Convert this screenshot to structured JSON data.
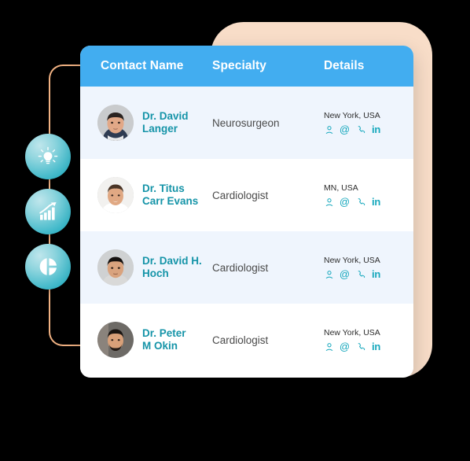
{
  "colors": {
    "header_blue": "#42adf0",
    "row_alt": "#eff5fd",
    "row_plain": "#ffffff",
    "name_teal": "#1594a8",
    "icon_teal": "#17a8bd",
    "peach_backdrop": "#f8ddc8",
    "connector_orange": "#f0b182",
    "badge_gradient_light": "#bfe6ec",
    "badge_gradient_dark": "#10a3b8",
    "canvas": "#000000"
  },
  "side_badges": [
    {
      "icon": "lightbulb-icon",
      "label": "Idea"
    },
    {
      "icon": "bar-chart-growth-icon",
      "label": "Growth"
    },
    {
      "icon": "pie-chart-icon",
      "label": "Analytics"
    }
  ],
  "table": {
    "columns": [
      {
        "key": "name",
        "label": "Contact Name"
      },
      {
        "key": "specialty",
        "label": "Specialty"
      },
      {
        "key": "details",
        "label": "Details"
      }
    ],
    "rows": [
      {
        "name_line1": "Dr. David",
        "name_line2": "Langer",
        "specialty": "Neurosurgeon",
        "location": "New York, USA",
        "avatar": "avatar-male-1",
        "detail_icons": [
          "person-icon",
          "email-at-icon",
          "phone-icon",
          "linkedin-icon"
        ]
      },
      {
        "name_line1": "Dr. Titus",
        "name_line2": "Carr Evans",
        "specialty": "Cardiologist",
        "location": "MN, USA",
        "avatar": "avatar-male-2",
        "detail_icons": [
          "person-icon",
          "email-at-icon",
          "phone-icon",
          "linkedin-icon"
        ]
      },
      {
        "name_line1": "Dr. David H.",
        "name_line2": "Hoch",
        "specialty": "Cardiologist",
        "location": "New York, USA",
        "avatar": "avatar-male-3",
        "detail_icons": [
          "person-icon",
          "email-at-icon",
          "phone-icon",
          "linkedin-icon"
        ]
      },
      {
        "name_line1": "Dr. Peter",
        "name_line2": "M Okin",
        "specialty": "Cardiologist",
        "location": "New York, USA",
        "avatar": "avatar-male-4",
        "detail_icons": [
          "person-icon",
          "email-at-icon",
          "phone-icon",
          "linkedin-icon"
        ]
      }
    ]
  },
  "icon_glyphs": {
    "email_at": "@",
    "linkedin": "in"
  }
}
